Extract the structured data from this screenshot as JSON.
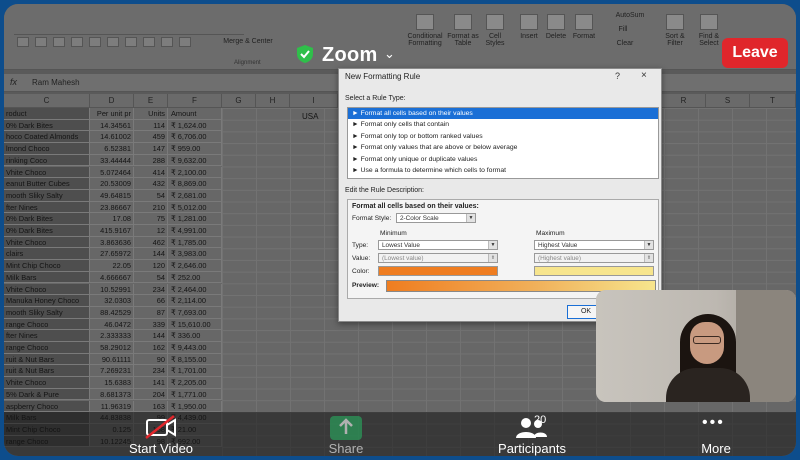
{
  "zoom": {
    "title": "Zoom",
    "leave_label": "Leave",
    "toolbar": {
      "start_video": "Start Video",
      "share": "Share",
      "participants": "Participants",
      "participants_count": "20",
      "more": "More"
    }
  },
  "excel": {
    "formula_value": "Ram Mahesh",
    "ribbon": {
      "merge": "Merge & Center",
      "conditional": "Conditional Formatting",
      "format_table": "Format as Table",
      "cell_styles": "Cell Styles",
      "insert": "Insert",
      "delete": "Delete",
      "format": "Format",
      "autosum": "AutoSum",
      "fill": "Fill",
      "clear": "Clear",
      "sort": "Sort & Filter",
      "find": "Find & Select",
      "alignment": "Alignment"
    },
    "columns": [
      "C",
      "D",
      "E",
      "F",
      "G",
      "H",
      "I",
      "R",
      "S",
      "T"
    ],
    "header_row": {
      "product": "roduct",
      "per_unit": "Per unit pr",
      "units": "Units",
      "amount": "Amount"
    },
    "usa_label": "USA",
    "rows": [
      [
        "0% Dark Bites",
        "14.34561",
        "114",
        "₹  1,624.00"
      ],
      [
        "hoco Coated Almonds",
        "14.61002",
        "459",
        "₹  6,706.00"
      ],
      [
        "lmond Choco",
        "6.52381",
        "147",
        "₹    959.00"
      ],
      [
        "rinking Coco",
        "33.44444",
        "288",
        "₹  9,632.00"
      ],
      [
        "Vhite Choco",
        "5.072464",
        "414",
        "₹  2,100.00"
      ],
      [
        "eanut Butter Cubes",
        "20.53009",
        "432",
        "₹  8,869.00"
      ],
      [
        "mooth Sliky Salty",
        "49.64815",
        "54",
        "₹  2,681.00"
      ],
      [
        "fter Nines",
        "23.86667",
        "210",
        "₹  5,012.00"
      ],
      [
        "0% Dark Bites",
        "17.08",
        "75",
        "₹  1,281.00"
      ],
      [
        "0% Dark Bites",
        "415.9167",
        "12",
        "₹  4,991.00"
      ],
      [
        "Vhite Choco",
        "3.863636",
        "462",
        "₹  1,785.00"
      ],
      [
        "clairs",
        "27.65972",
        "144",
        "₹  3,983.00"
      ],
      [
        "Mint Chip Choco",
        "22.05",
        "120",
        "₹  2,646.00"
      ],
      [
        "Milk Bars",
        "4.666667",
        "54",
        "₹    252.00"
      ],
      [
        "Vhite Choco",
        "10.52991",
        "234",
        "₹  2,464.00"
      ],
      [
        "Manuka Honey Choco",
        "32.0303",
        "66",
        "₹  2,114.00"
      ],
      [
        "mooth Sliky Salty",
        "88.42529",
        "87",
        "₹  7,693.00"
      ],
      [
        "range Choco",
        "46.0472",
        "339",
        "₹ 15,610.00"
      ],
      [
        "fter Nines",
        "2.333333",
        "144",
        "₹    336.00"
      ],
      [
        "range Choco",
        "58.29012",
        "162",
        "₹  9,443.00"
      ],
      [
        "ruit & Nut Bars",
        "90.61111",
        "90",
        "₹  8,155.00"
      ],
      [
        "ruit & Nut Bars",
        "7.269231",
        "234",
        "₹  1,701.00"
      ],
      [
        "Vhite Choco",
        "15.6383",
        "141",
        "₹  2,205.00"
      ],
      [
        "5% Dark & Pure",
        "8.681373",
        "204",
        "₹  1,771.00"
      ],
      [
        "aspberry Choco",
        "11.96319",
        "163",
        "₹  1,950.00"
      ],
      [
        "Milk Bars",
        "44.83838",
        "99",
        "₹  4,439.00"
      ],
      [
        "Mint Chip Choco",
        "0.125",
        "168",
        "₹     21.00"
      ],
      [
        "range Choco",
        "10.12245",
        "98",
        "₹    992.00"
      ]
    ]
  },
  "dialog": {
    "title": "New Formatting Rule",
    "help": "?",
    "close": "×",
    "select_label": "Select a Rule Type:",
    "rules": [
      "► Format all cells based on their values",
      "► Format only cells that contain",
      "► Format only top or bottom ranked values",
      "► Format only values that are above or below average",
      "► Format only unique or duplicate values",
      "► Use a formula to determine which cells to format"
    ],
    "edit_label": "Edit the Rule Description:",
    "desc_title": "Format all cells based on their values:",
    "format_style_label": "Format Style:",
    "format_style_value": "2-Color Scale",
    "minimum": "Minimum",
    "maximum": "Maximum",
    "type_label": "Type:",
    "value_label": "Value:",
    "color_label": "Color:",
    "min_type": "Lowest Value",
    "max_type": "Highest Value",
    "min_value": "(Lowest value)",
    "max_value": "(Highest value)",
    "preview_label": "Preview:",
    "ok": "OK",
    "colors": {
      "min": "#ef7d20",
      "max": "#f7e58d",
      "selected_rule": "#1a6fd6"
    }
  },
  "colors": {
    "leave": "#e0262b",
    "share": "#27ae60",
    "outer": "#0d4d8c"
  }
}
